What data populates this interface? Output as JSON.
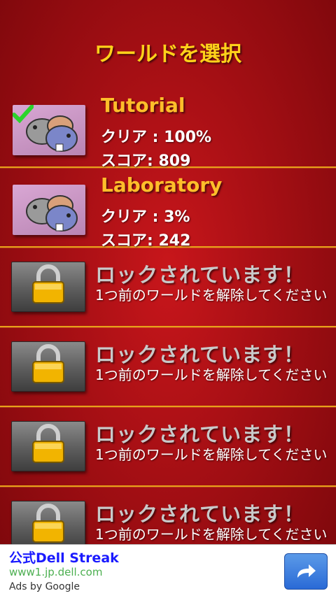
{
  "header": {
    "title": "ワールドを選択"
  },
  "worlds": [
    {
      "name": "Tutorial",
      "clear": "クリア : 100%",
      "score": "スコア: 809",
      "completed": true
    },
    {
      "name": "Laboratory",
      "clear": "クリア : 3%",
      "score": "スコア: 242",
      "completed": false
    }
  ],
  "locked": [
    {
      "title": "ロックされています！",
      "subtitle": "1つ前のワールドを解除してください"
    },
    {
      "title": "ロックされています！",
      "subtitle": "1つ前のワールドを解除してください"
    },
    {
      "title": "ロックされています！",
      "subtitle": "1つ前のワールドを解除してください"
    },
    {
      "title": "ロックされています！",
      "subtitle": "1つ前のワールドを解除してください"
    }
  ],
  "ad": {
    "title": "公式Dell Streak",
    "url": "www1.jp.dell.com",
    "by": "Ads by Google",
    "icon": "arrow-forward-icon"
  },
  "colors": {
    "background": "#b3121a",
    "title": "#ffd21a",
    "world_name": "#ffbe2a",
    "divider": "#e8a11a"
  }
}
